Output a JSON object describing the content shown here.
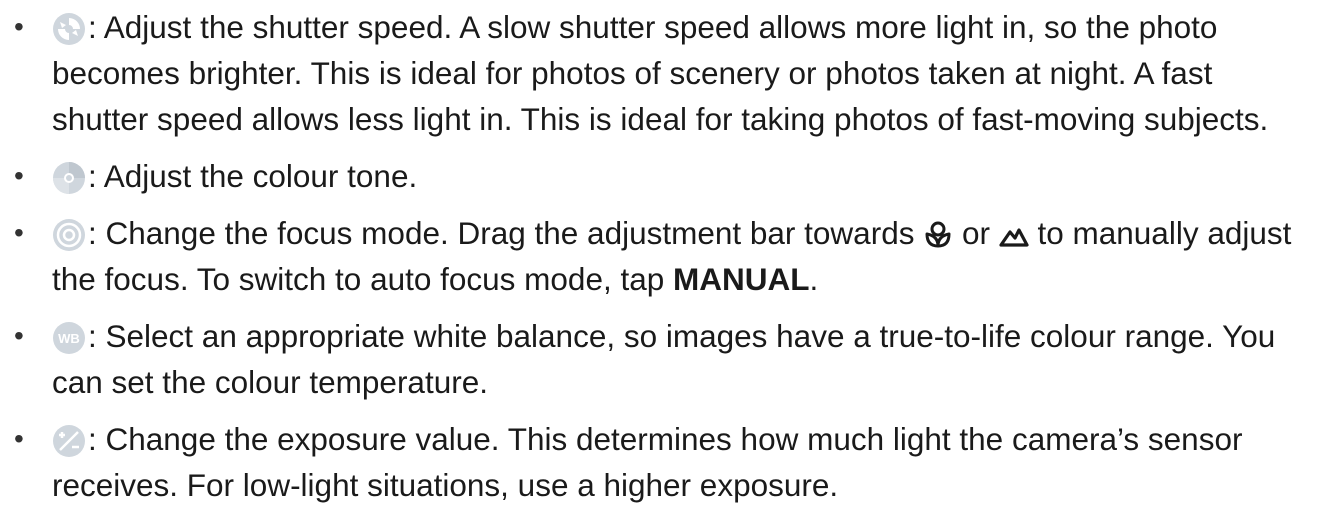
{
  "items": [
    {
      "icon": "shutter-speed-icon",
      "text": ": Adjust the shutter speed. A slow shutter speed allows more light in, so the photo becomes brighter. This is ideal for photos of scenery or photos taken at night. A fast shutter speed allows less light in. This is ideal for taking photos of fast-moving subjects."
    },
    {
      "icon": "colour-tone-icon",
      "text": ": Adjust the colour tone."
    },
    {
      "icon": "focus-mode-icon",
      "text_before": ": Change the focus mode. Drag the adjustment bar towards ",
      "icon_macro": "macro-flower-icon",
      "text_or": " or ",
      "icon_landscape": "landscape-mountain-icon",
      "text_after": " to manually adjust the focus. To switch to auto focus mode, tap ",
      "bold": "MANUAL",
      "text_end": "."
    },
    {
      "icon": "white-balance-icon",
      "icon_label": "WB",
      "text": ": Select an appropriate white balance, so images have a true-to-life colour range. You can set the colour temperature."
    },
    {
      "icon": "exposure-value-icon",
      "text": ": Change the exposure value. This determines how much light the camera’s sensor receives. For low-light situations, use a higher exposure."
    }
  ],
  "bullet": "•",
  "colors": {
    "icon_fill": "#cfd6dd",
    "icon_accent": "#ffffff",
    "icon_dark": "#1a1a1a"
  }
}
